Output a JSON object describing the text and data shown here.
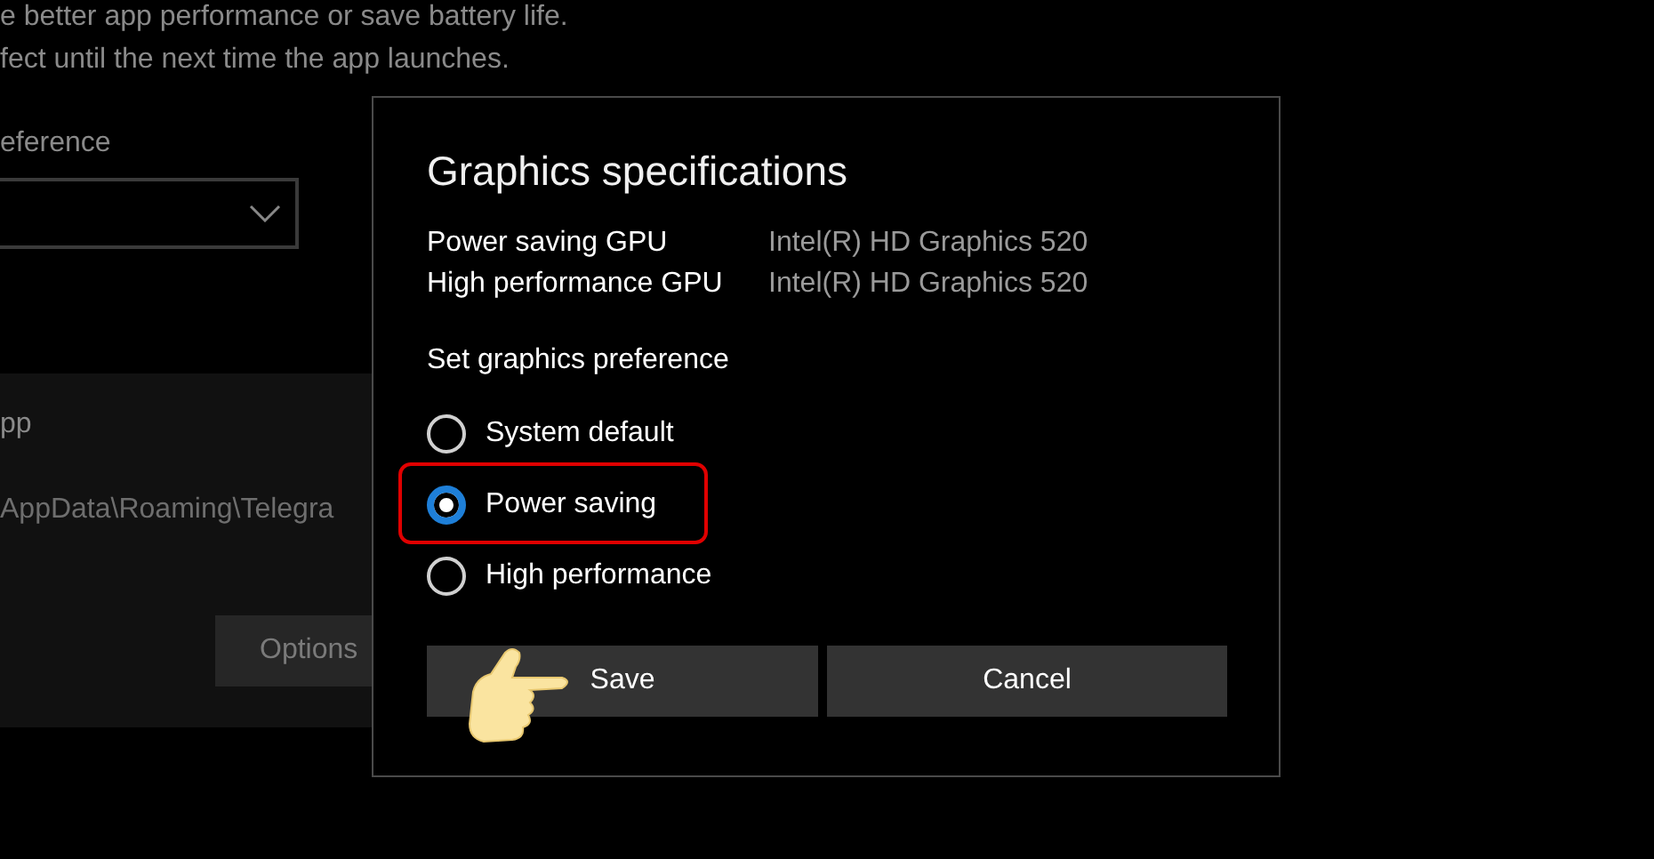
{
  "background": {
    "description_lines": [
      "e better app performance or save battery life.",
      "fect until the next time the app launches."
    ],
    "preference_label": "eference",
    "app_card": {
      "name": "pp",
      "path": "AppData\\Roaming\\Telegra",
      "options_button": "Options"
    }
  },
  "dialog": {
    "title": "Graphics specifications",
    "specs": [
      {
        "label": "Power saving GPU",
        "value": "Intel(R) HD Graphics 520"
      },
      {
        "label": "High performance GPU",
        "value": "Intel(R) HD Graphics 520"
      }
    ],
    "preference_heading": "Set graphics preference",
    "options": [
      {
        "label": "System default",
        "selected": false,
        "highlighted": false
      },
      {
        "label": "Power saving",
        "selected": true,
        "highlighted": true
      },
      {
        "label": "High performance",
        "selected": false,
        "highlighted": false
      }
    ],
    "buttons": [
      {
        "label": "Save",
        "pointed_at": true
      },
      {
        "label": "Cancel",
        "pointed_at": false
      }
    ]
  }
}
